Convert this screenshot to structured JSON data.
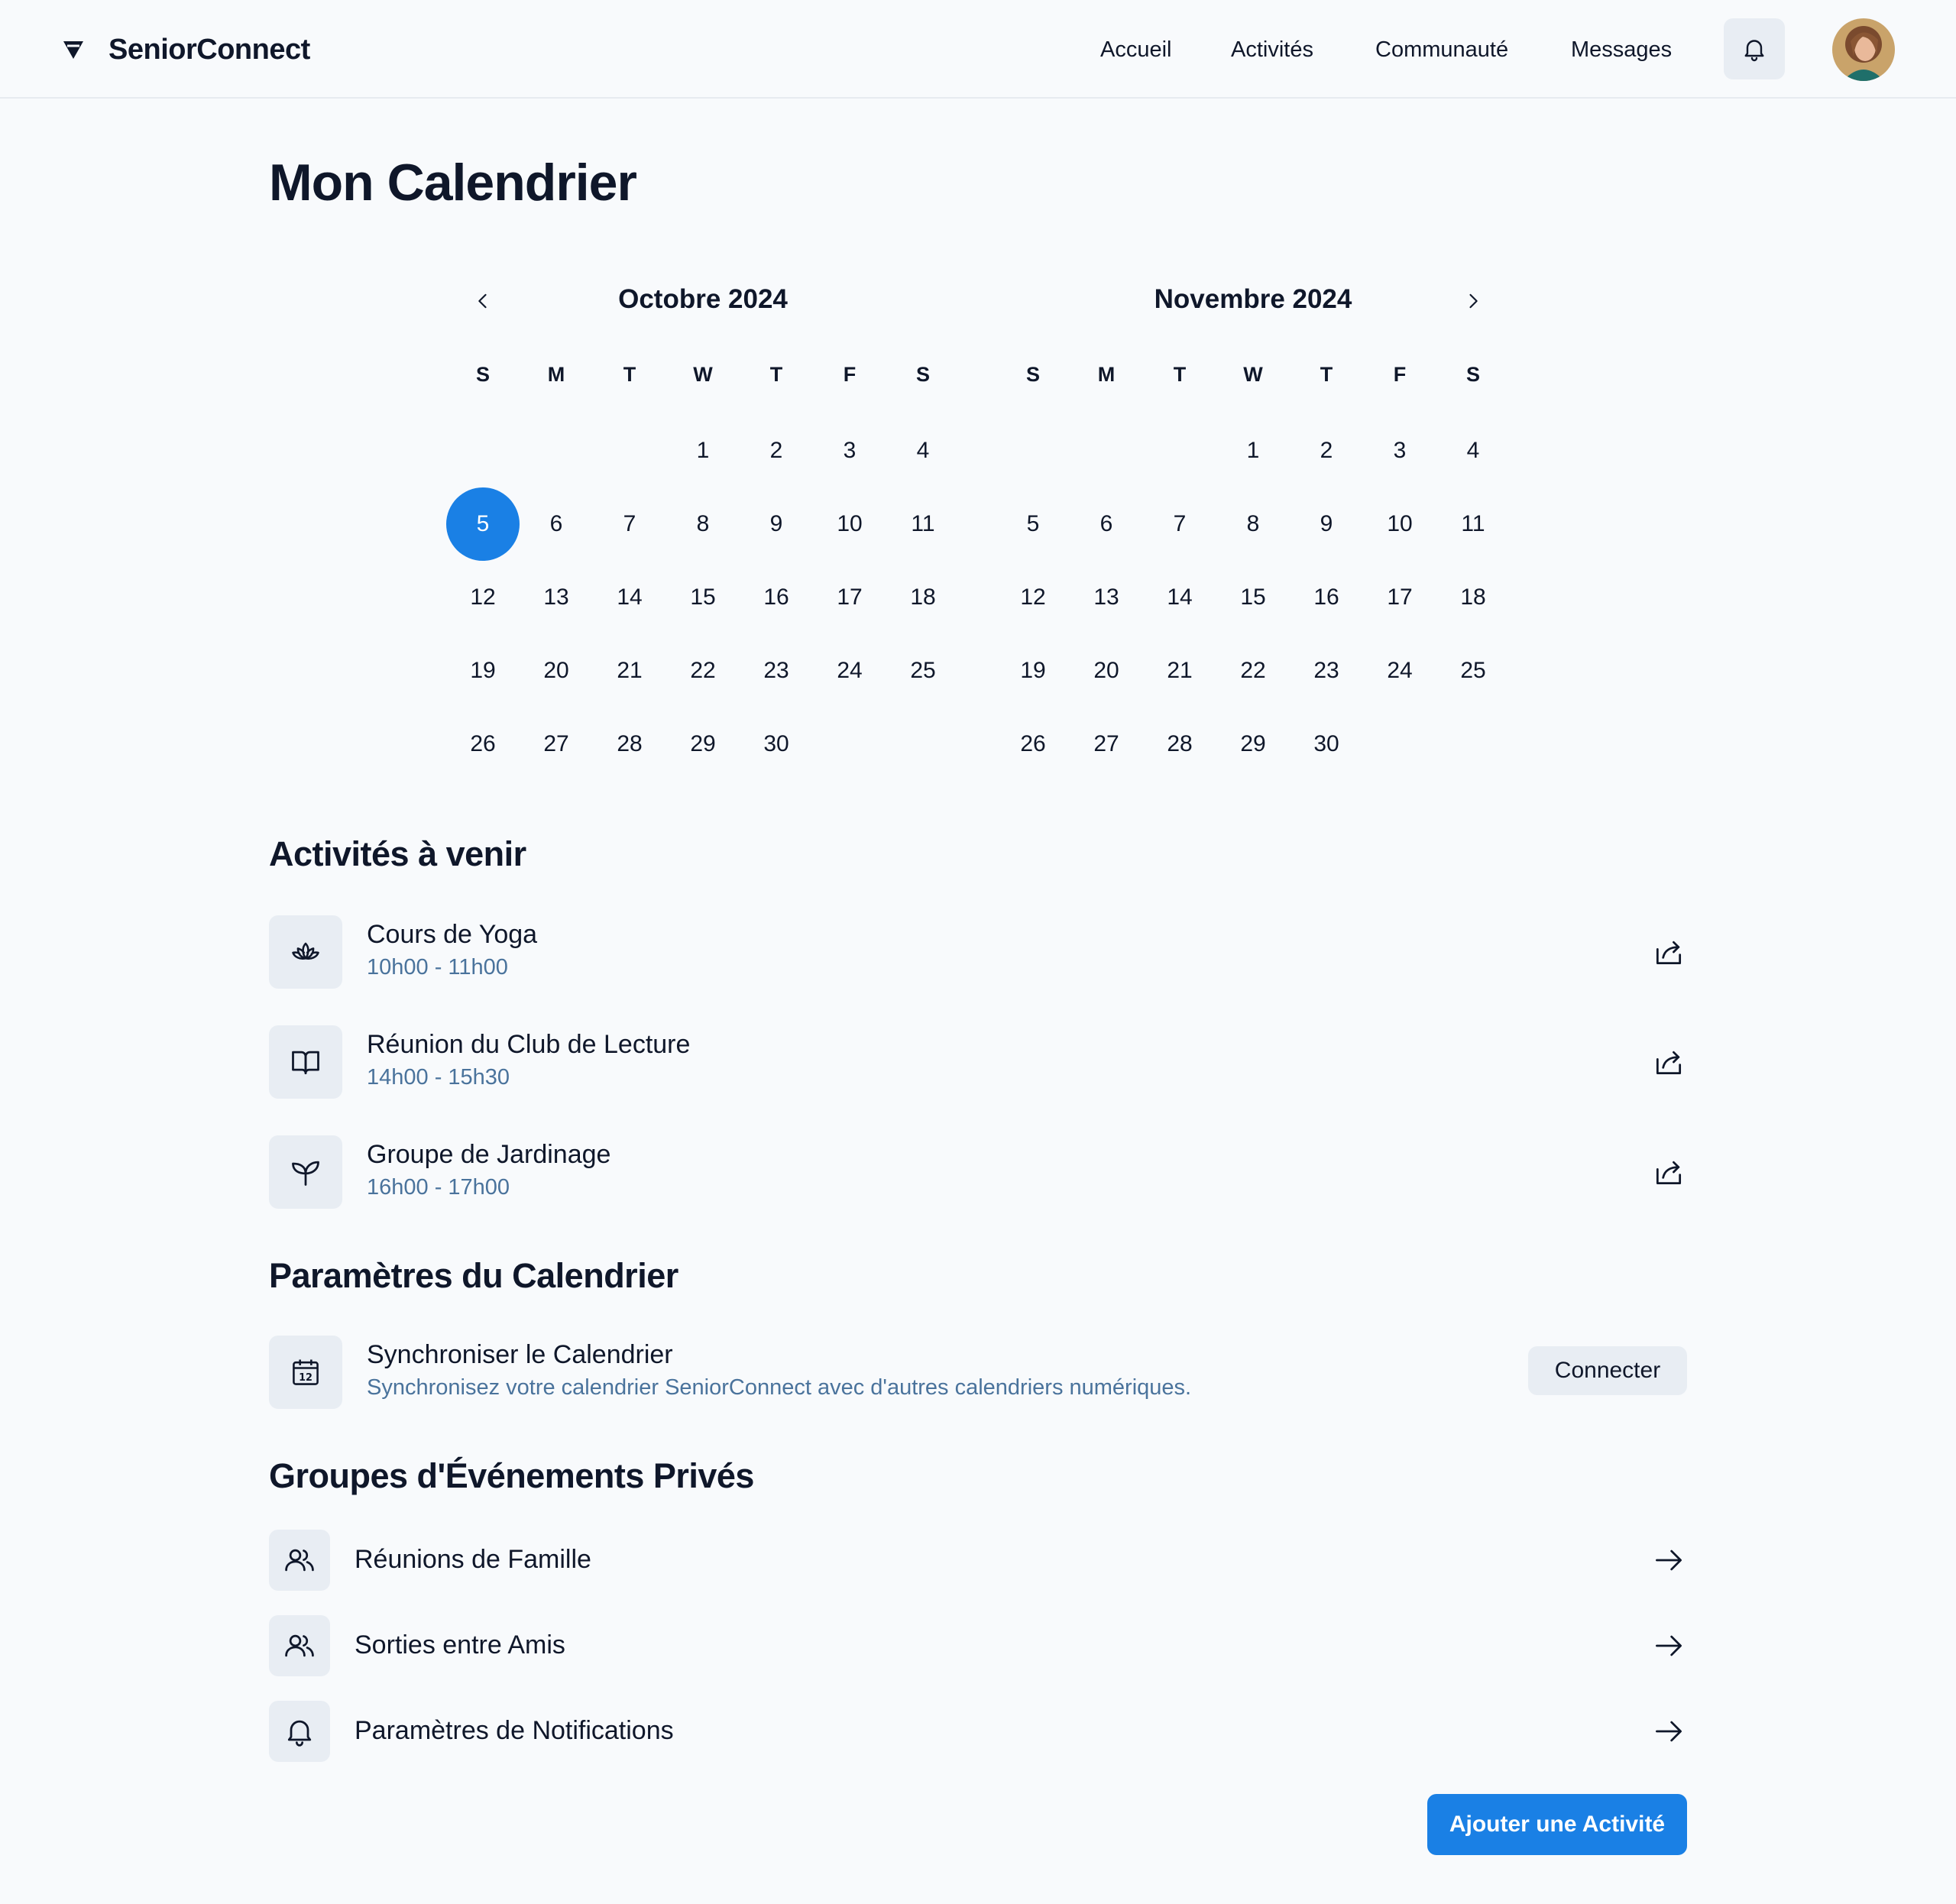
{
  "header": {
    "brand_name": "SeniorConnect",
    "nav": [
      "Accueil",
      "Activités",
      "Communauté",
      "Messages"
    ]
  },
  "page": {
    "title": "Mon Calendrier"
  },
  "calendar": {
    "weekday_headers": [
      "S",
      "M",
      "T",
      "W",
      "T",
      "F",
      "S"
    ],
    "months": [
      {
        "title": "Octobre 2024",
        "first_weekday_index": 3,
        "days": [
          "1",
          "2",
          "3",
          "4",
          "5",
          "6",
          "7",
          "8",
          "9",
          "10",
          "11",
          "12",
          "13",
          "14",
          "15",
          "16",
          "17",
          "18",
          "19",
          "20",
          "21",
          "22",
          "23",
          "24",
          "25",
          "26",
          "27",
          "28",
          "29",
          "30"
        ],
        "selected_day": "5"
      },
      {
        "title": "Novembre 2024",
        "first_weekday_index": 3,
        "days": [
          "1",
          "2",
          "3",
          "4",
          "5",
          "6",
          "7",
          "8",
          "9",
          "10",
          "11",
          "12",
          "13",
          "14",
          "15",
          "16",
          "17",
          "18",
          "19",
          "20",
          "21",
          "22",
          "23",
          "24",
          "25",
          "26",
          "27",
          "28",
          "29",
          "30"
        ],
        "selected_day": null
      }
    ]
  },
  "upcoming": {
    "title": "Activités à venir",
    "items": [
      {
        "title": "Cours de Yoga",
        "time": "10h00 - 11h00",
        "icon": "lotus-icon"
      },
      {
        "title": "Réunion du Club de Lecture",
        "time": "14h00 - 15h30",
        "icon": "book-icon"
      },
      {
        "title": "Groupe de Jardinage",
        "time": "16h00 - 17h00",
        "icon": "plant-icon"
      }
    ]
  },
  "settings": {
    "title": "Paramètres du Calendrier",
    "sync_title": "Synchroniser le Calendrier",
    "sync_desc": "Synchronisez votre calendrier SeniorConnect avec d'autres calendriers numériques.",
    "connect_label": "Connecter",
    "calendar_icon_number": "12"
  },
  "groups": {
    "title": "Groupes d'Événements Privés",
    "items": [
      {
        "label": "Réunions de Famille",
        "icon": "users-icon"
      },
      {
        "label": "Sorties entre Amis",
        "icon": "users-icon"
      },
      {
        "label": "Paramètres de Notifications",
        "icon": "bell-icon"
      }
    ]
  },
  "add_button": "Ajouter une Activité",
  "colors": {
    "accent": "#1a80e5",
    "muted_text": "#4a739c",
    "chip_bg": "#e8edf3",
    "background": "#f8fafc"
  }
}
